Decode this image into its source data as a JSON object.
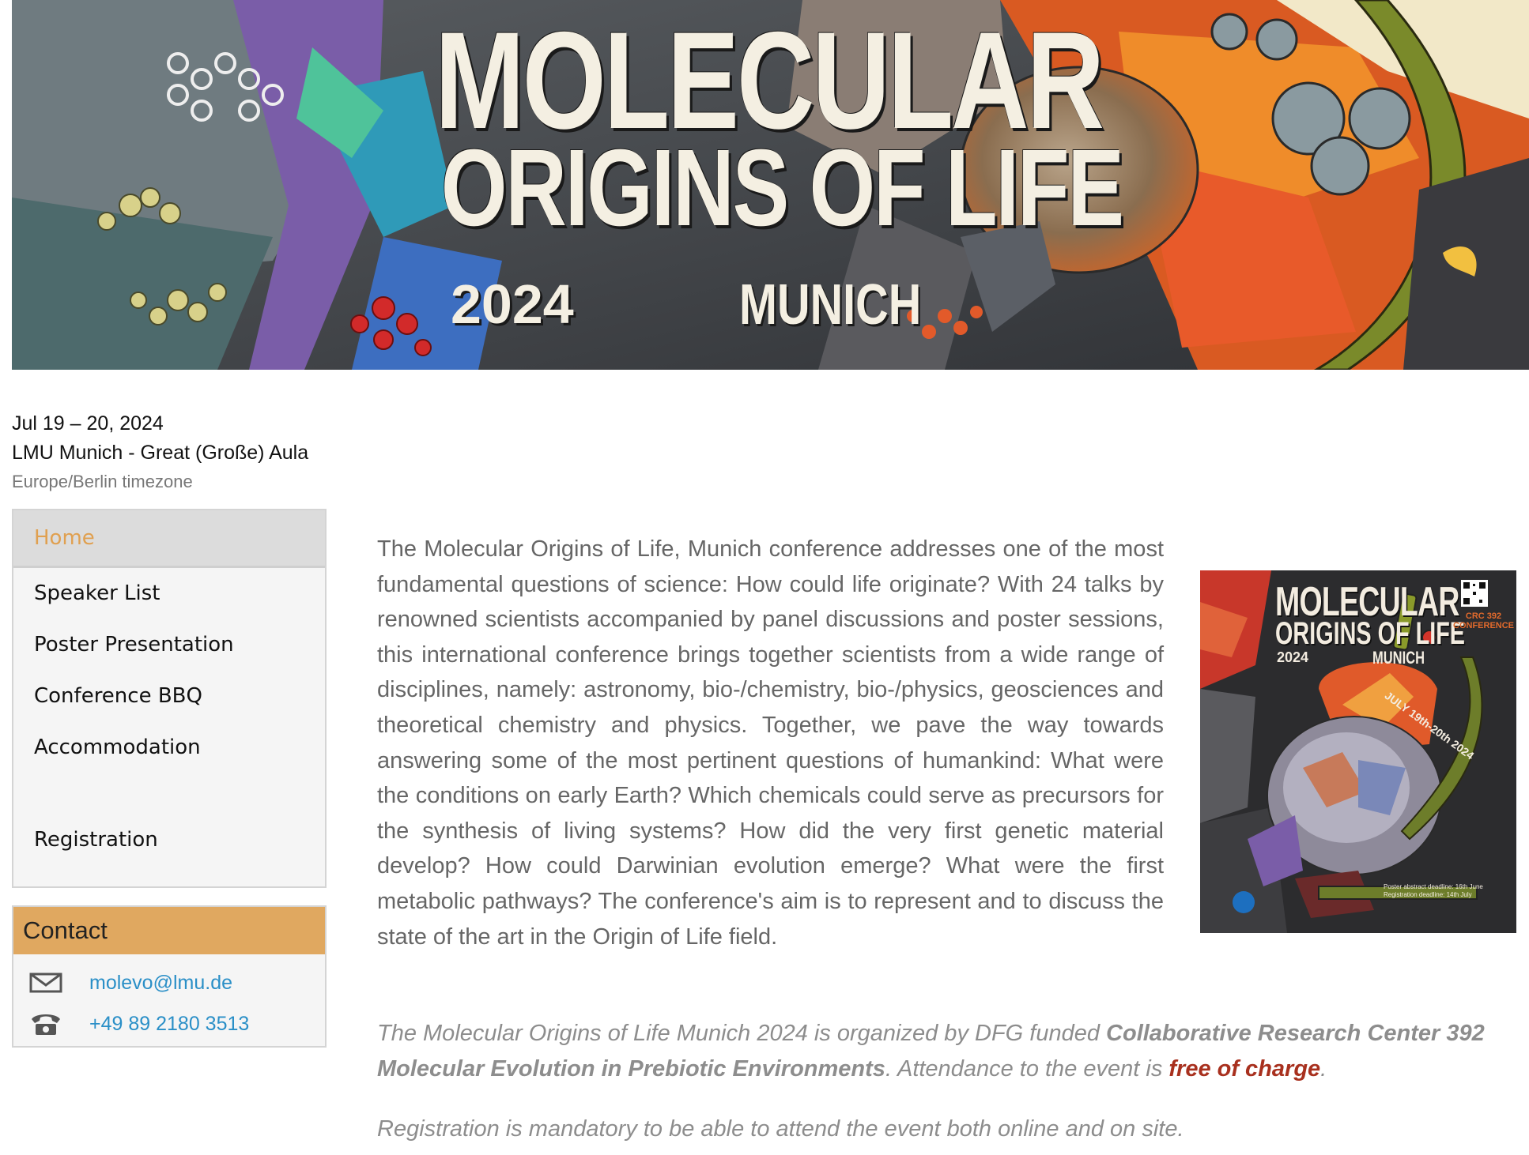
{
  "banner": {
    "title_line1": "MOLECULAR",
    "title_line2": "ORIGINS OF LIFE",
    "year": "2024",
    "city": "MUNICH"
  },
  "event": {
    "date": "Jul 19 – 20, 2024",
    "venue": "LMU Munich - Great (Große) Aula",
    "timezone": "Europe/Berlin timezone"
  },
  "menu": {
    "items": [
      {
        "label": "Home",
        "active": true
      },
      {
        "label": "Speaker List"
      },
      {
        "label": "Poster Presentation"
      },
      {
        "label": "Conference BBQ"
      },
      {
        "label": "Accommodation"
      },
      {
        "label": "Registration"
      }
    ]
  },
  "contact": {
    "title": "Contact",
    "email": "molevo@lmu.de",
    "phone": "+49 89 2180 3513",
    "email_icon": "envelope-icon",
    "phone_icon": "telephone-icon"
  },
  "content": {
    "intro": "The Molecular Origins of Life, Munich conference addresses one of the most fundamental questions of science: How could life originate? With 24 talks by renowned scientists accompanied by panel discussions and poster sessions, this international conference brings together scientists from a wide range of disciplines, namely: astronomy, bio-/chemistry, bio-/physics, geosciences and theoretical chemistry and physics. Together, we pave the way towards answering some of the most pertinent questions of humankind: What were the conditions on early Earth? Which chemicals could serve as precursors for the synthesis of living systems? How did the very first genetic material develop? How could Darwinian evolution emerge? What were the first metabolic pathways? The conference's aim is to represent and to discuss the state of the art in the Origin of Life field.",
    "org_prefix": "The Molecular Origins of Life Munich 2024 is organized by DFG funded ",
    "org_center": "Collaborative Research Center 392 Molecular Evolution in Prebiotic Environments",
    "org_middle": ". Attendance to the event is ",
    "org_free": "free of charge",
    "org_suffix": ".",
    "registration_note": "Registration is mandatory to be able to attend the event both online and on site."
  },
  "poster": {
    "title_line1": "MOLECULAR",
    "title_line2": "ORIGINS OF LIFE",
    "year": "2024",
    "city": "MUNICH",
    "crc": "CRC 392\nCONFERENCE",
    "dates": "JULY 19th-20th 2024",
    "deadline1": "Poster abstract deadline: 16th June",
    "deadline2": "Registration deadline: 14th July"
  },
  "colors": {
    "accent_orange": "#e0a860",
    "active_menu_text": "#e0a050",
    "link_blue": "#2a8fc7",
    "free_red": "#a8301e"
  }
}
